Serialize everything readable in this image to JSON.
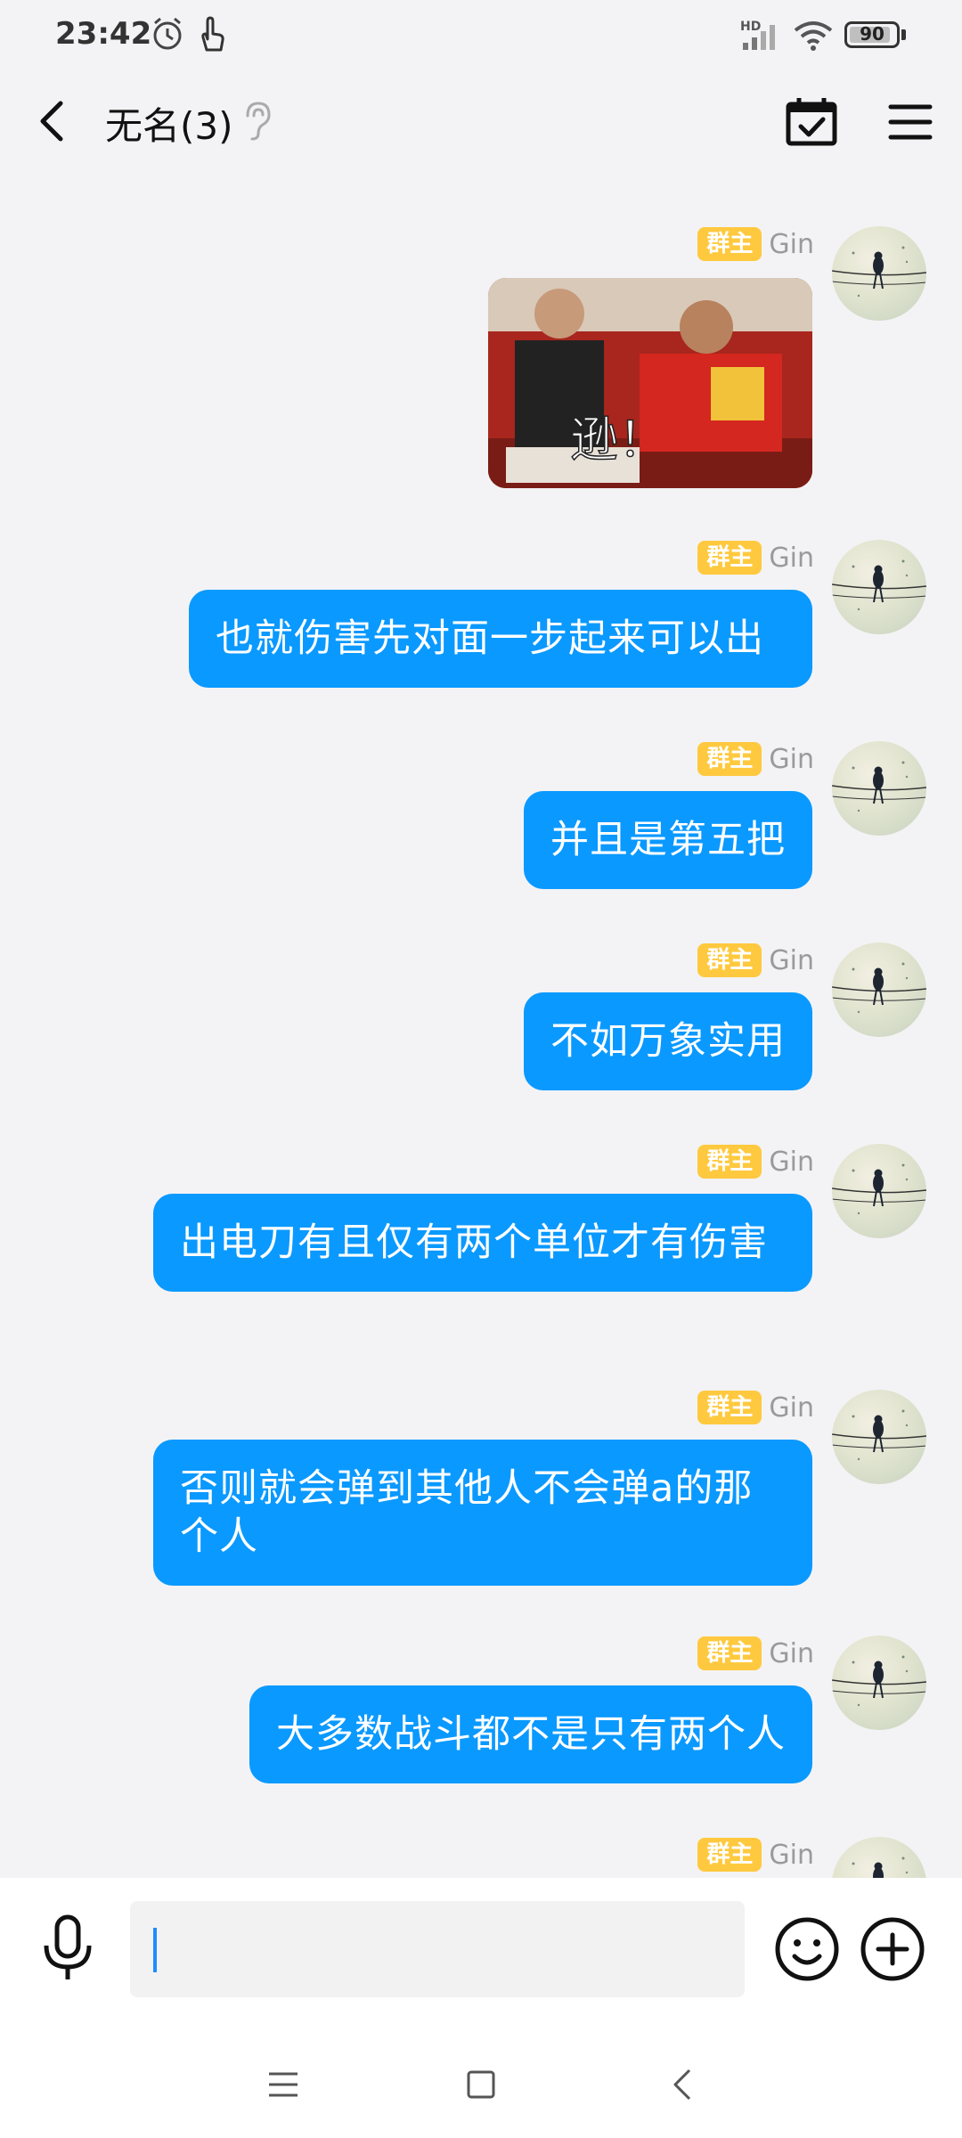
{
  "status_bar": {
    "time": "23:42",
    "network_label": "HD",
    "battery": "90",
    "battery_level": 0.9
  },
  "header": {
    "title": "无名(3)"
  },
  "messages": [
    {
      "role": "群主",
      "sender": "Gin",
      "type": "image",
      "image_caption": "逊！"
    },
    {
      "role": "群主",
      "sender": "Gin",
      "type": "text",
      "text": "也就伤害先对面一步起来可以出"
    },
    {
      "role": "群主",
      "sender": "Gin",
      "type": "text",
      "text": "并且是第五把"
    },
    {
      "role": "群主",
      "sender": "Gin",
      "type": "text",
      "text": "不如万象实用"
    },
    {
      "role": "群主",
      "sender": "Gin",
      "type": "text",
      "text": "出电刀有且仅有两个单位才有伤害"
    },
    {
      "role": "群主",
      "sender": "Gin",
      "type": "text",
      "text": "否则就会弹到其他人不会弹a的那个人"
    },
    {
      "role": "群主",
      "sender": "Gin",
      "type": "text",
      "text": "大多数战斗都不是只有两个人"
    },
    {
      "role": "群主",
      "sender": "Gin",
      "type": "text",
      "text": ""
    }
  ],
  "input": {
    "value": "",
    "placeholder": ""
  },
  "colors": {
    "bubble": "#0a99ff",
    "badge": "#ffc93f",
    "background": "#f3f3f5"
  },
  "icons": {
    "back": "chevron-left-icon",
    "ear": "ear-icon",
    "calendar": "calendar-check-icon",
    "menu": "hamburger-icon",
    "mic": "microphone-icon",
    "emoji": "smiley-icon",
    "plus": "plus-circle-icon"
  }
}
